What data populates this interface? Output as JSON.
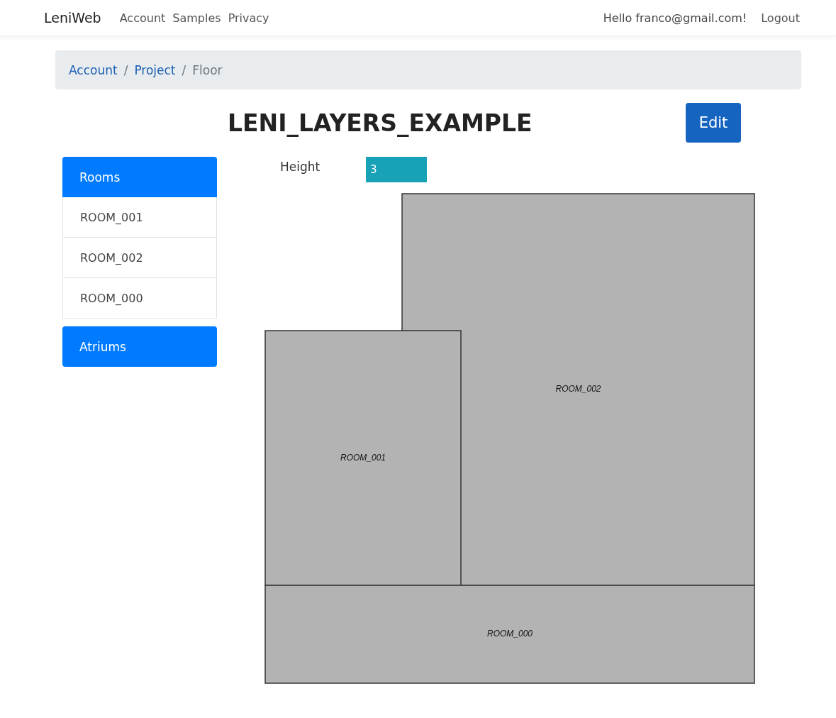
{
  "navbar": {
    "brand": "LeniWeb",
    "links": [
      "Account",
      "Samples",
      "Privacy"
    ],
    "greeting": "Hello franco@gmail.com!",
    "logout": "Logout"
  },
  "breadcrumb": [
    {
      "kind": "link",
      "label": "Account"
    },
    {
      "kind": "separator",
      "label": "/"
    },
    {
      "kind": "link",
      "label": "Project"
    },
    {
      "kind": "separator",
      "label": "/"
    },
    {
      "kind": "current",
      "label": "Floor"
    }
  ],
  "title": "LENI_LAYERS_EXAMPLE",
  "edit_button": "Edit",
  "sidebar": [
    {
      "title": "Rooms",
      "items": [
        "ROOM_001",
        "ROOM_002",
        "ROOM_000"
      ]
    },
    {
      "title": "Atriums"
    }
  ],
  "height": {
    "label": "Height",
    "value": "3"
  },
  "floor_plan": {
    "rooms": [
      {
        "name": "ROOM_002"
      },
      {
        "name": "ROOM_001"
      },
      {
        "name": "ROOM_000"
      }
    ]
  }
}
